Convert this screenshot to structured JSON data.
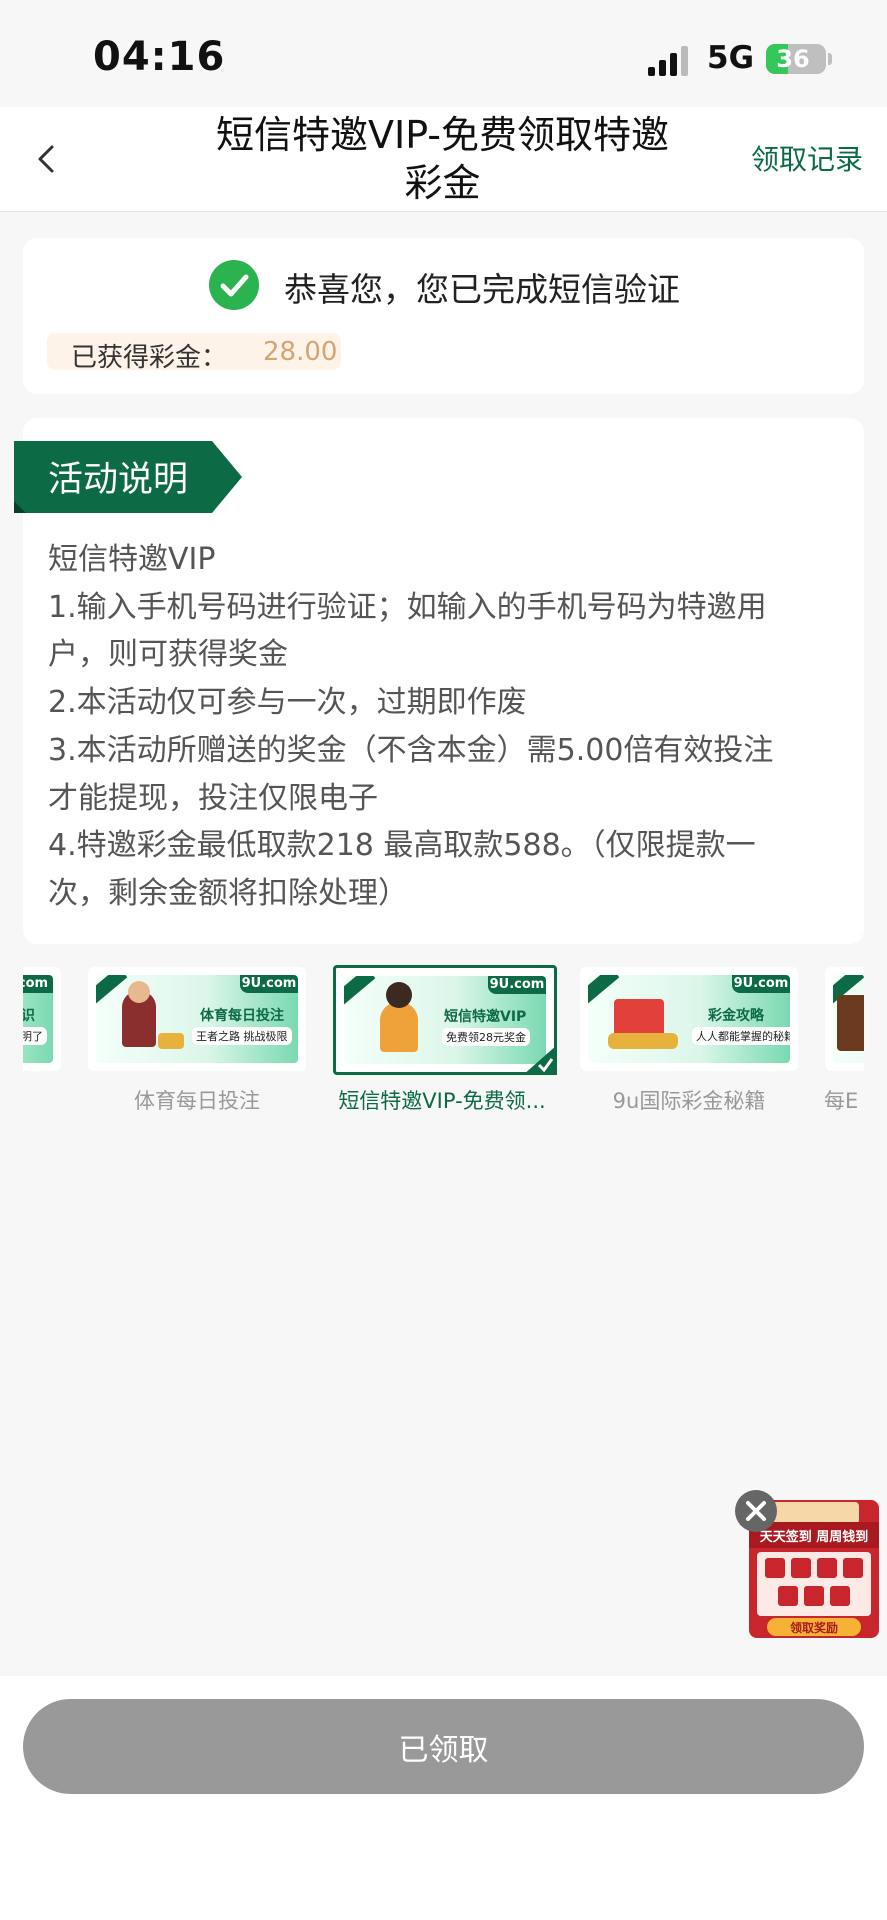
{
  "status_bar": {
    "time": "04:16",
    "network": "5G",
    "battery": "36",
    "battery_level": 0.36
  },
  "nav": {
    "title_line1": "短信特邀VIP-免费领取特邀",
    "title_line2": "彩金",
    "right_link": "领取记录",
    "back_icon": "chevron-left-icon"
  },
  "result": {
    "message": "恭喜您，您已完成短信验证",
    "bonus_label": "已获得彩金：",
    "bonus_value": "28.00"
  },
  "description": {
    "heading": "活动说明",
    "lines": [
      "短信特邀VIP",
      "1.输入手机号码进行验证；如输入的手机号码为特邀用",
      "户，则可获得奖金",
      "2.本活动仅可参与一次，过期即作废",
      "3.本活动所赠送的奖金（不含本金）需5.00倍有效投注",
      "才能提现，投注仅限电子",
      "4.特邀彩金最低取款218  最高取款588。（仅限提款一",
      "次，剩余金额将扣除处理）"
    ]
  },
  "carousel": [
    {
      "caption": "明了",
      "brand": "",
      "headline": "识",
      "sub": "明了"
    },
    {
      "caption": "体育每日投注",
      "brand": "9U.com",
      "headline": "体育每日投注",
      "sub": "王者之路 挑战极限"
    },
    {
      "caption": "短信特邀VIP-免费领...",
      "brand": "9U.com",
      "headline": "短信特邀VIP",
      "sub": "免费领28元奖金",
      "selected": true
    },
    {
      "caption": "9u国际彩金秘籍",
      "brand": "9U.com",
      "headline": "彩金攻略",
      "sub": "人人都能掌握的秘籍"
    },
    {
      "caption": "每E",
      "brand": "",
      "headline": "",
      "sub": ""
    }
  ],
  "float_ad": {
    "title": "天天签到 周周钱到",
    "button": "领取奖励",
    "close_icon": "close-icon"
  },
  "claim_button": "已领取",
  "colors": {
    "brand_green": "#0c6b45",
    "success_green": "#2bb34f",
    "bonus_gold": "#d6a472",
    "disabled_gray": "#999999"
  }
}
